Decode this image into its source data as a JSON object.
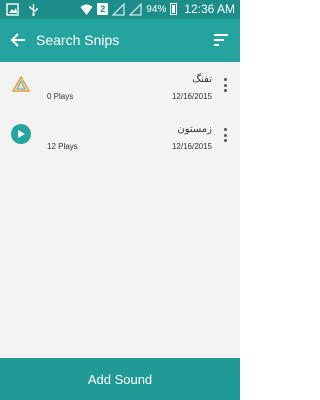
{
  "status_bar": {
    "icons_left": [
      "gallery-icon",
      "usb-icon"
    ],
    "sim_badge": "2",
    "battery_percent": "94%",
    "time": "12:36 AM"
  },
  "app_bar": {
    "title": "Search Snips",
    "back_icon": "arrow-left-icon",
    "sort_icon": "sort-icon"
  },
  "snips": [
    {
      "name": "تفنگ",
      "plays": "0 Plays",
      "date": "12/16/2015",
      "icon": "warning-triangle-icon"
    },
    {
      "name": "زمستون",
      "plays": "12 Plays",
      "date": "12/16/2015",
      "icon": "play-icon"
    }
  ],
  "bottom_bar": {
    "label": "Add Sound"
  },
  "colors": {
    "status_bar": "#1d8d89",
    "app_bar": "#25a39e",
    "bottom_bar": "#1f9a96"
  }
}
